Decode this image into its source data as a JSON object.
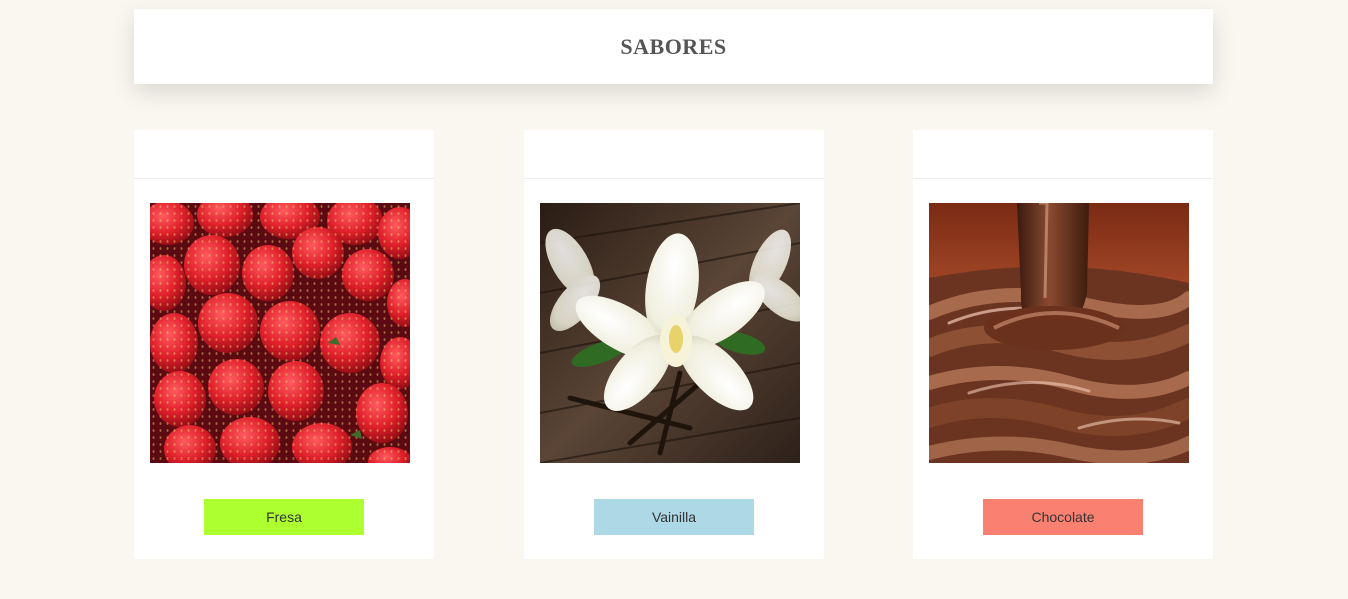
{
  "header": {
    "title": "SABORES"
  },
  "cards": [
    {
      "button_label": "Fresa",
      "button_color": "#adff2f",
      "image": "strawberries-photo"
    },
    {
      "button_label": "Vainilla",
      "button_color": "#add8e6",
      "image": "vanilla-flower-photo"
    },
    {
      "button_label": "Chocolate",
      "button_color": "#fa8072",
      "image": "melted-chocolate-photo"
    }
  ]
}
